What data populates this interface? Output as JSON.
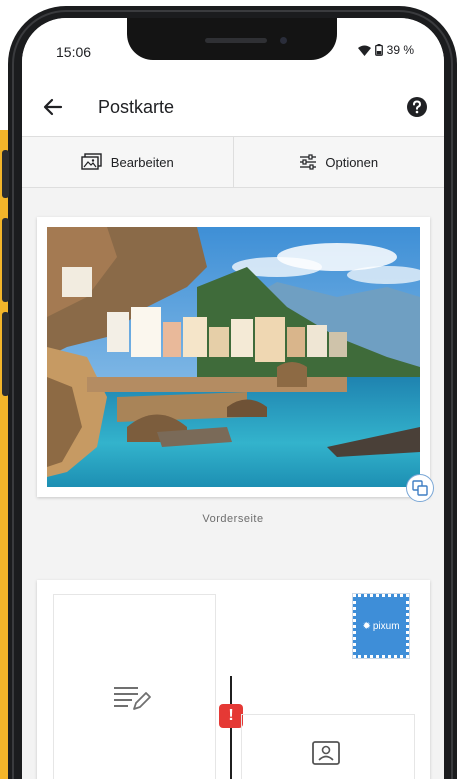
{
  "status_bar": {
    "time": "15:06",
    "battery": "39 %"
  },
  "app_bar": {
    "title": "Postkarte"
  },
  "toolbar": {
    "edit_label": "Bearbeiten",
    "options_label": "Optionen"
  },
  "front": {
    "side_label": "Vorderseite"
  },
  "back": {
    "stamp_brand": "pixum"
  },
  "colors": {
    "accent_yellow": "#f3b52a",
    "stamp_blue": "#3e8ed8",
    "warning_red": "#e53935"
  }
}
